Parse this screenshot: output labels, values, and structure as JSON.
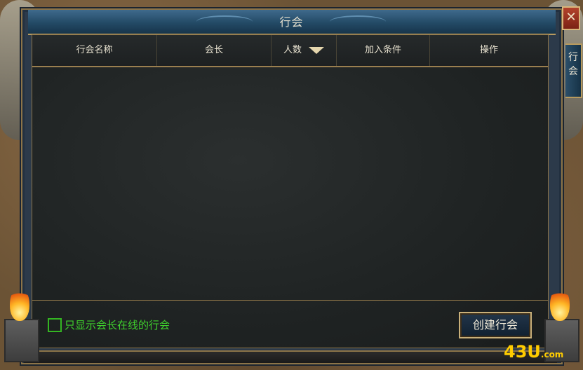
{
  "window": {
    "title": "行会",
    "close_label": "✕",
    "side_tab": "行\n会"
  },
  "table": {
    "columns": [
      "行会名称",
      "会长",
      "人数",
      "加入条件",
      "操作"
    ],
    "rows": []
  },
  "filter": {
    "checkbox_label": "只显示会长在线的行会",
    "checked": false
  },
  "actions": {
    "create_label": "创建行会"
  },
  "branding": {
    "logo_main": "43U",
    "logo_suffix": ".com"
  },
  "colors": {
    "accent_gold": "#c9b07a",
    "checkbox_green": "#3fd12d",
    "panel_dark": "#1f2323"
  }
}
